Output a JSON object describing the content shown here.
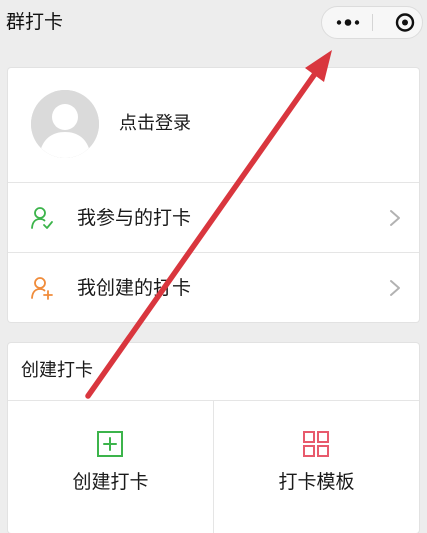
{
  "nav": {
    "title": "群打卡",
    "more_icon": "more-dots-icon",
    "close_icon": "target-circle-icon"
  },
  "user_card": {
    "avatar_icon": "default-avatar-icon",
    "login_label": "点击登录",
    "items": [
      {
        "label": "我参与的打卡",
        "icon": "person-check-icon",
        "icon_color": "#3cb44b"
      },
      {
        "label": "我创建的打卡",
        "icon": "person-add-icon",
        "icon_color": "#f08c3b"
      }
    ]
  },
  "create_card": {
    "title": "创建打卡",
    "tiles": [
      {
        "label": "创建打卡",
        "icon": "plus-square-icon",
        "icon_color": "#3cb44b"
      },
      {
        "label": "打卡模板",
        "icon": "grid-icon",
        "icon_color": "#e85a6c"
      }
    ]
  },
  "annotation": {
    "arrow_color": "#d9363e",
    "arrow_icon": "red-arrow-icon"
  }
}
